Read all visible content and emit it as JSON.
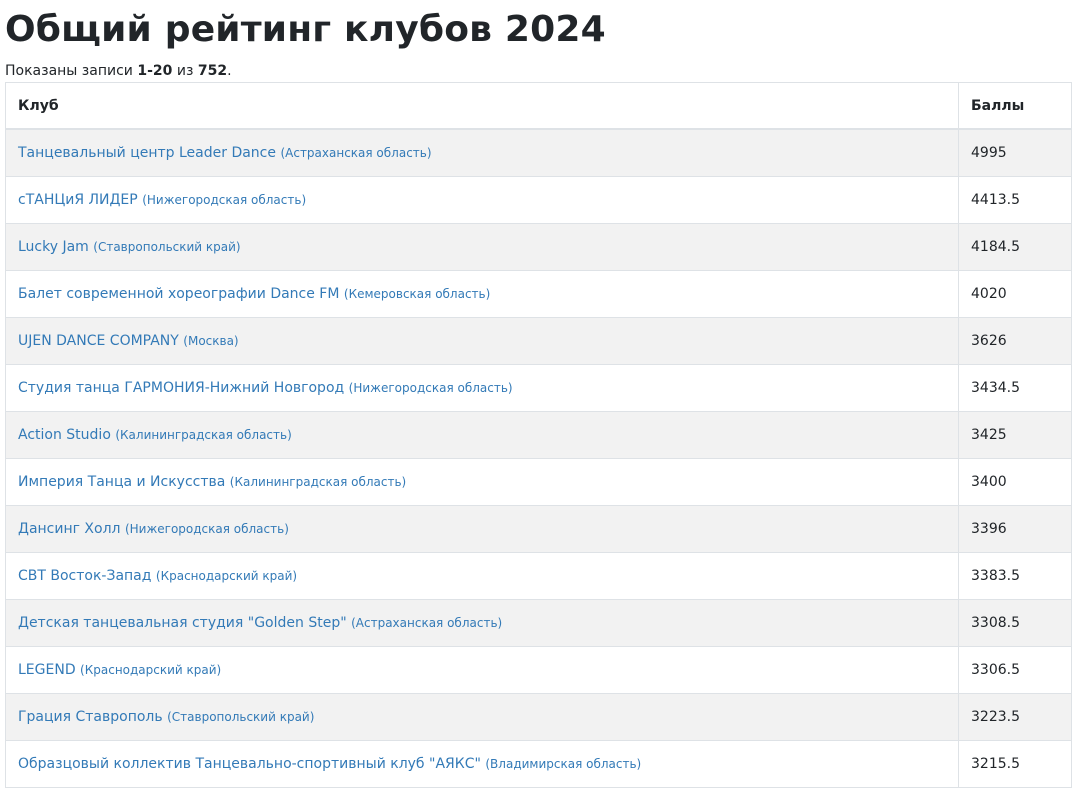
{
  "page": {
    "title": "Общий рейтинг клубов 2024",
    "summary_prefix": "Показаны записи ",
    "summary_range": "1-20",
    "summary_middle": " из ",
    "summary_total": "752",
    "summary_suffix": "."
  },
  "table": {
    "headers": {
      "club": "Клуб",
      "score": "Баллы"
    },
    "rows": [
      {
        "club": "Танцевальный центр Leader Dance",
        "region": "(Астраханская область)",
        "score": "4995"
      },
      {
        "club": "сТАНЦиЯ ЛИДЕР",
        "region": "(Нижегородская область)",
        "score": "4413.5"
      },
      {
        "club": "Lucky Jam",
        "region": "(Ставропольский край)",
        "score": "4184.5"
      },
      {
        "club": "Балет современной хореографии Dance FM",
        "region": "(Кемеровская область)",
        "score": "4020"
      },
      {
        "club": "UJEN DANCE COMPANY",
        "region": "(Москва)",
        "score": "3626"
      },
      {
        "club": "Студия танца ГАРМОНИЯ-Нижний Новгород",
        "region": "(Нижегородская область)",
        "score": "3434.5"
      },
      {
        "club": "Action Studio",
        "region": "(Калининградская область)",
        "score": "3425"
      },
      {
        "club": "Империя Танца и Искусства",
        "region": "(Калининградская область)",
        "score": "3400"
      },
      {
        "club": "Дансинг Холл",
        "region": "(Нижегородская область)",
        "score": "3396"
      },
      {
        "club": "СВТ Восток-Запад",
        "region": "(Краснодарский край)",
        "score": "3383.5"
      },
      {
        "club": "Детская танцевальная студия \"Golden Step\"",
        "region": "(Астраханская область)",
        "score": "3308.5"
      },
      {
        "club": "LEGEND",
        "region": "(Краснодарский край)",
        "score": "3306.5"
      },
      {
        "club": "Грация Ставрополь",
        "region": "(Ставропольский край)",
        "score": "3223.5"
      },
      {
        "club": "Образцовый коллектив Танцевально-спортивный клуб \"АЯКС\"",
        "region": "(Владимирская область)",
        "score": "3215.5"
      }
    ]
  },
  "colors": {
    "link": "#337ab7",
    "stripe": "#f2f2f2",
    "border": "#dee2e6"
  }
}
